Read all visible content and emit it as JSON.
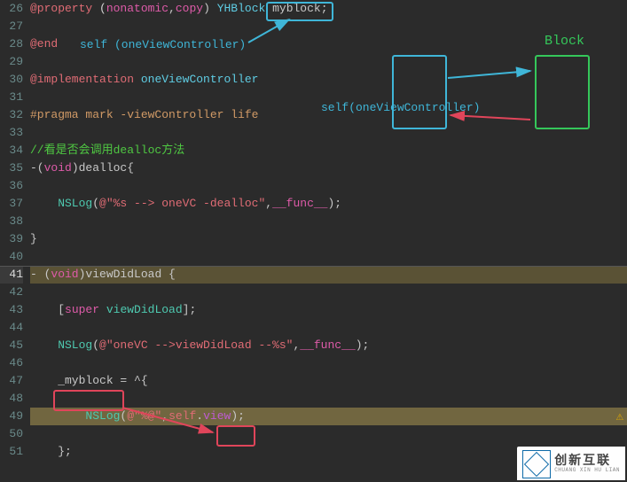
{
  "lines": [
    {
      "n": 26,
      "tokens": [
        {
          "t": "@property",
          "c": "kw-red"
        },
        {
          "t": " (",
          "c": "kw-white"
        },
        {
          "t": "nonatomic",
          "c": "kw-pink"
        },
        {
          "t": ",",
          "c": ""
        },
        {
          "t": "copy",
          "c": "kw-pink"
        },
        {
          "t": ") ",
          "c": ""
        },
        {
          "t": "YHBlock",
          "c": "kw-cyan"
        },
        {
          "t": " myblock;",
          "c": ""
        }
      ]
    },
    {
      "n": 27,
      "tokens": []
    },
    {
      "n": 28,
      "tokens": [
        {
          "t": "@end",
          "c": "kw-red"
        }
      ]
    },
    {
      "n": 29,
      "tokens": []
    },
    {
      "n": 30,
      "tokens": [
        {
          "t": "@implementation",
          "c": "kw-red"
        },
        {
          "t": " ",
          "c": ""
        },
        {
          "t": "oneViewController",
          "c": "kw-cyan"
        }
      ]
    },
    {
      "n": 31,
      "tokens": []
    },
    {
      "n": 32,
      "tokens": [
        {
          "t": "#pragma mark -viewController life",
          "c": "kw-orange"
        }
      ]
    },
    {
      "n": 33,
      "tokens": []
    },
    {
      "n": 34,
      "tokens": [
        {
          "t": "//看是否会调用dealloc方法",
          "c": "kw-green"
        }
      ]
    },
    {
      "n": 35,
      "tokens": [
        {
          "t": "-(",
          "c": ""
        },
        {
          "t": "void",
          "c": "kw-pink"
        },
        {
          "t": ")dealloc{",
          "c": ""
        }
      ]
    },
    {
      "n": 36,
      "tokens": []
    },
    {
      "n": 37,
      "tokens": [
        {
          "t": "    NSLog",
          "c": "kw-teal"
        },
        {
          "t": "(",
          "c": ""
        },
        {
          "t": "@\"%s --> oneVC -dealloc\"",
          "c": "kw-red"
        },
        {
          "t": ",",
          "c": ""
        },
        {
          "t": "__func__",
          "c": "kw-pink"
        },
        {
          "t": ");",
          "c": ""
        }
      ]
    },
    {
      "n": 38,
      "tokens": []
    },
    {
      "n": 39,
      "tokens": [
        {
          "t": "}",
          "c": ""
        }
      ]
    },
    {
      "n": 40,
      "tokens": []
    },
    {
      "n": 41,
      "hl": true,
      "tokens": [
        {
          "t": "- (",
          "c": ""
        },
        {
          "t": "void",
          "c": "kw-pink"
        },
        {
          "t": ")viewDidLoad {",
          "c": ""
        }
      ]
    },
    {
      "n": 42,
      "tokens": []
    },
    {
      "n": 43,
      "tokens": [
        {
          "t": "    [",
          "c": ""
        },
        {
          "t": "super",
          "c": "kw-pink"
        },
        {
          "t": " ",
          "c": ""
        },
        {
          "t": "viewDidLoad",
          "c": "kw-teal"
        },
        {
          "t": "];",
          "c": ""
        }
      ]
    },
    {
      "n": 44,
      "tokens": []
    },
    {
      "n": 45,
      "tokens": [
        {
          "t": "    NSLog",
          "c": "kw-teal"
        },
        {
          "t": "(",
          "c": ""
        },
        {
          "t": "@\"oneVC -->viewDidLoad --%s\"",
          "c": "kw-red"
        },
        {
          "t": ",",
          "c": ""
        },
        {
          "t": "__func__",
          "c": "kw-pink"
        },
        {
          "t": ");",
          "c": ""
        }
      ]
    },
    {
      "n": 46,
      "tokens": []
    },
    {
      "n": 47,
      "tokens": [
        {
          "t": "    _myblock = ^{",
          "c": ""
        }
      ]
    },
    {
      "n": 48,
      "tokens": []
    },
    {
      "n": 49,
      "hl2": true,
      "tokens": [
        {
          "t": "        NSLog",
          "c": "kw-teal"
        },
        {
          "t": "(",
          "c": ""
        },
        {
          "t": "@\"%@\"",
          "c": "kw-red"
        },
        {
          "t": ",",
          "c": ""
        },
        {
          "t": "self",
          "c": "kw-red"
        },
        {
          "t": ".",
          "c": ""
        },
        {
          "t": "view",
          "c": "kw-purple"
        },
        {
          "t": ");",
          "c": ""
        }
      ]
    },
    {
      "n": 50,
      "tokens": []
    },
    {
      "n": 51,
      "tokens": [
        {
          "t": "    };",
          "c": ""
        }
      ]
    }
  ],
  "annotations": {
    "yhblock_label": "YHBlock",
    "self_ovc": "self (oneViewController)",
    "self_ovc2": "self(oneViewController)",
    "block_label": "Block"
  },
  "watermark": {
    "big": "创新互联",
    "small": "CHUANG XIN HU LIAN"
  }
}
